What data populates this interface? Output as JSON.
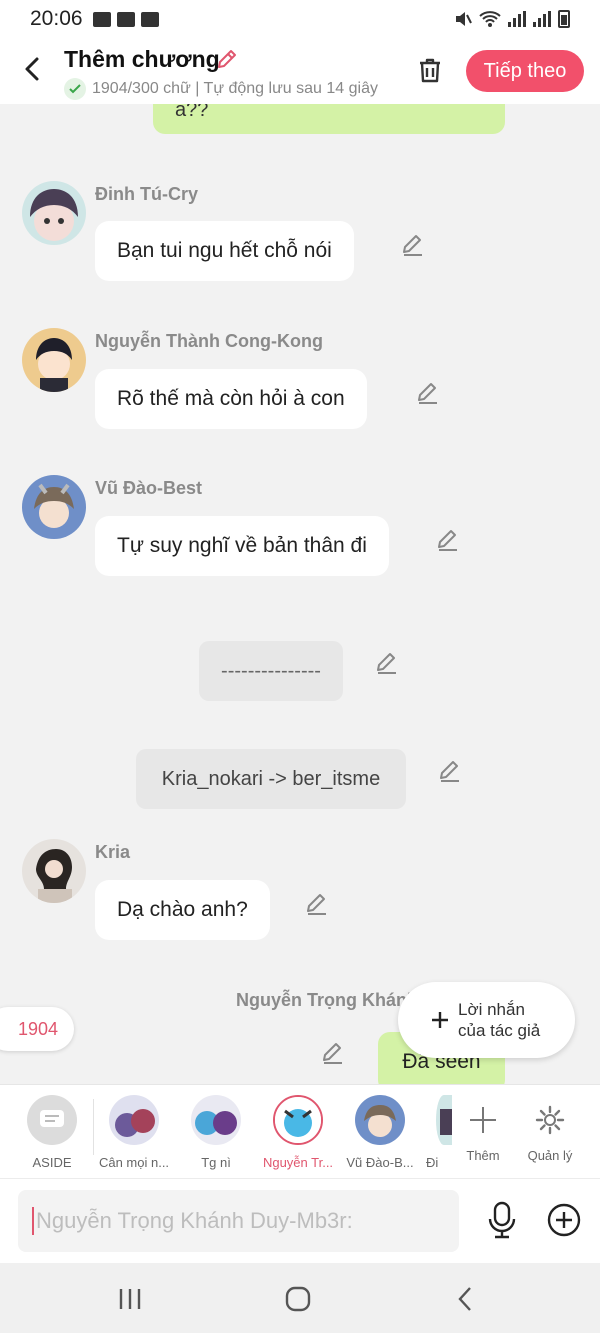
{
  "status_bar": {
    "time": "20:06"
  },
  "header": {
    "title": "Thêm chương",
    "subtitle": "1904/300 chữ | Tự động lưu sau 14 giây",
    "next_label": "Tiếp theo"
  },
  "messages": {
    "partial_top": "a??",
    "dinh": {
      "name": "Đinh Tú-Cry",
      "text": "Bạn tui ngu hết chỗ nói"
    },
    "nguyen_thanh": {
      "name": "Nguyễn Thành Cong-Kong",
      "text": "Rõ thế mà còn hỏi à con"
    },
    "vu_dao": {
      "name": "Vũ Đào-Best",
      "text": "Tự suy nghĩ về bản thân đi"
    },
    "divider": "---------------",
    "rename": "Kria_nokari -> ber_itsme",
    "kria": {
      "name": "Kria",
      "text": "Dạ chào anh?"
    },
    "nguyen_trong": {
      "name": "Nguyễn Trọng Khánh",
      "text": "Đã seen"
    }
  },
  "word_count_pill": "1904",
  "author_note": {
    "line1": "Lời nhắn",
    "line2": "của tác giả"
  },
  "characters": [
    {
      "label": "ASIDE"
    },
    {
      "label": "Cân mọi n..."
    },
    {
      "label": "Tg nì"
    },
    {
      "label": "Nguyễn Tr..."
    },
    {
      "label": "Vũ Đào-B..."
    },
    {
      "label": "Đi"
    }
  ],
  "strip_actions": {
    "add": "Thêm",
    "manage": "Quản lý"
  },
  "input": {
    "placeholder": "Nguyễn Trọng Khánh Duy-Mb3r:"
  },
  "colors": {
    "accent": "#f2506b",
    "green_bubble": "#d4f2a6",
    "pink_text": "#e0566e"
  }
}
